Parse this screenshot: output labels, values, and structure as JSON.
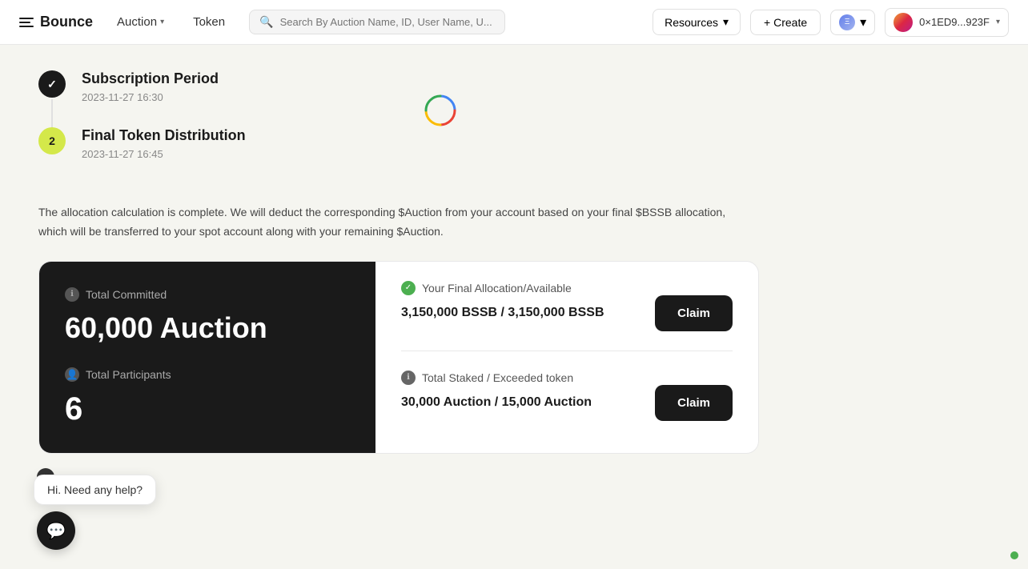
{
  "brand": {
    "name": "Bounce"
  },
  "nav": {
    "auction_label": "Auction",
    "token_label": "Token",
    "resources_label": "Resources",
    "create_label": "+ Create",
    "search_placeholder": "Search By Auction Name, ID, User Name, U...",
    "wallet_address": "0×1ED9...923F"
  },
  "timeline": {
    "step1": {
      "bullet": "✓",
      "title": "Subscription Period",
      "timestamp": "2023-11-27 16:30"
    },
    "step2": {
      "bullet": "2",
      "title": "Final Token Distribution",
      "timestamp": "2023-11-27 16:45"
    }
  },
  "description": "The allocation calculation is complete. We will deduct the corresponding $Auction from your account based on your final $BSSB allocation, which will be transferred to your spot account along with your remaining $Auction.",
  "card": {
    "total_committed_label": "Total Committed",
    "total_committed_value": "60,000 Auction",
    "total_participants_label": "Total Participants",
    "total_participants_value": "6",
    "final_allocation_label": "Your Final Allocation/Available",
    "final_allocation_value": "3,150,000 BSSB / 3,150,000 BSSB",
    "claim_label_1": "Claim",
    "total_staked_label": "Total Staked / Exceeded token",
    "total_staked_value": "30,000 Auction / 15,000 Auction",
    "claim_label_2": "Claim"
  },
  "chat": {
    "message": "Hi. Need any help?",
    "close_label": "×"
  },
  "icons": {
    "info": "ℹ",
    "check": "✓",
    "user": "👤",
    "chevron": "▾",
    "search": "🔍",
    "message": "💬"
  }
}
